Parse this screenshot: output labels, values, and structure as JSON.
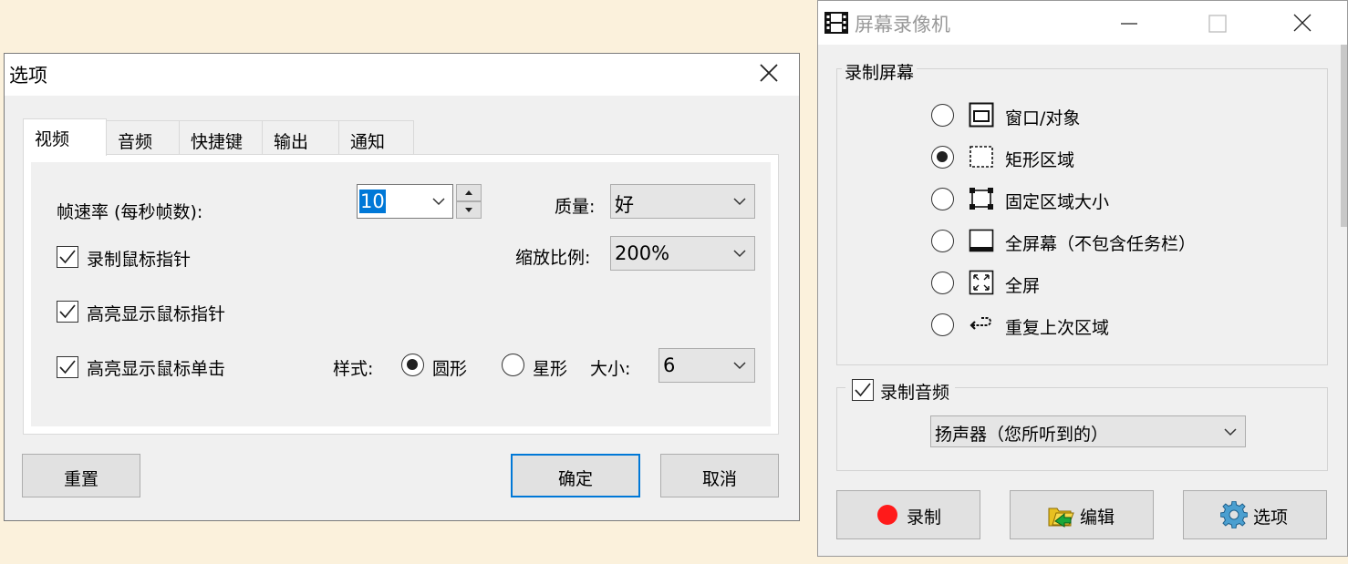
{
  "options_dialog": {
    "title": "选项",
    "tabs": [
      {
        "label": "视频",
        "active": true
      },
      {
        "label": "音频",
        "active": false
      },
      {
        "label": "快捷键",
        "active": false
      },
      {
        "label": "输出",
        "active": false
      },
      {
        "label": "通知",
        "active": false
      }
    ],
    "video": {
      "fps_label": "帧速率 (每秒帧数):",
      "fps_value": "10",
      "quality_label": "质量:",
      "quality_value": "好",
      "record_cursor_label": "录制鼠标指针",
      "record_cursor_checked": true,
      "scale_label": "缩放比例:",
      "scale_value": "200%",
      "highlight_cursor_label": "高亮显示鼠标指针",
      "highlight_cursor_checked": true,
      "highlight_click_label": "高亮显示鼠标单击",
      "highlight_click_checked": true,
      "style_label": "样式:",
      "style_circle": "圆形",
      "style_star": "星形",
      "style_selected": "circle",
      "size_label": "大小:",
      "size_value": "6"
    },
    "buttons": {
      "reset": "重置",
      "ok": "确定",
      "cancel": "取消"
    }
  },
  "recorder": {
    "title": "屏幕录像机",
    "record_screen_group": "录制屏幕",
    "modes": [
      {
        "label": "窗口/对象",
        "icon": "window-object-icon",
        "selected": false
      },
      {
        "label": "矩形区域",
        "icon": "rectangle-region-icon",
        "selected": true
      },
      {
        "label": "固定区域大小",
        "icon": "fixed-region-icon",
        "selected": false
      },
      {
        "label": "全屏幕（不包含任务栏）",
        "icon": "fullscreen-no-taskbar-icon",
        "selected": false
      },
      {
        "label": "全屏",
        "icon": "fullscreen-icon",
        "selected": false
      },
      {
        "label": "重复上次区域",
        "icon": "repeat-last-region-icon",
        "selected": false
      }
    ],
    "record_audio_label": "录制音频",
    "record_audio_checked": true,
    "audio_source": "扬声器（您所听到的）",
    "buttons": {
      "record": "录制",
      "edit": "编辑",
      "options": "选项"
    },
    "colors": {
      "record_dot": "#ff1a1a",
      "focus_blue": "#0078d7"
    }
  }
}
